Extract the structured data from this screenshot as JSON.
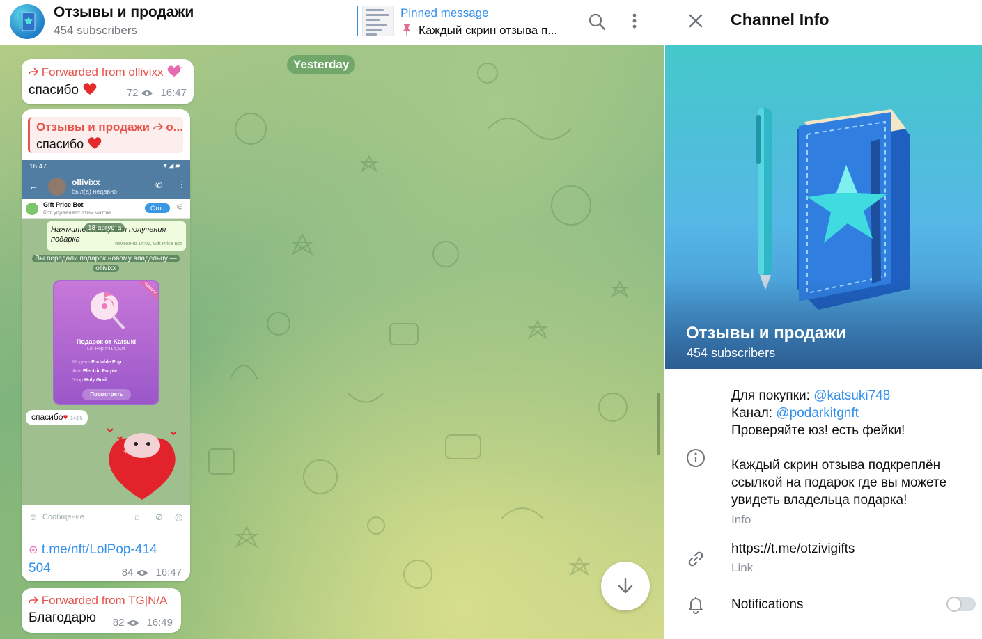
{
  "header": {
    "channel_name": "Отзывы и продажи",
    "subscribers": "454 subscribers",
    "pinned_label": "Pinned message",
    "pinned_text": "Каждый скрин отзыва п..."
  },
  "chat": {
    "date_chip": "Yesterday",
    "messages": [
      {
        "forwarded": "Forwarded from ollivixx",
        "text": "спасибо",
        "views": "72",
        "time": "16:47"
      },
      {
        "reply_title": "Отзывы и продажи",
        "reply_suffix": "о...",
        "reply_text": "спасибо",
        "link_line1": "t.me/nft/LolPop-414",
        "link_line2": "504",
        "views": "84",
        "time": "16:47"
      },
      {
        "forwarded": "Forwarded from TG|N/A",
        "text": "Благодарю",
        "views": "82",
        "time": "16:49"
      }
    ],
    "screenshot": {
      "status_time": "16:47",
      "contact_name": "ollivixx",
      "contact_status": "был(а) недавно",
      "bot_name": "Gift Price Bot",
      "bot_desc": "бот управляет этим чатом",
      "bot_button": "Стоп",
      "date": "18 августа",
      "bot_message": "Нажмите кнопку для получения подарка",
      "bot_message_meta": "изменено 14:06, Gift Price Bot",
      "service_line1": "Вы передали подарок новому владельцу —",
      "service_line2": "ollivixx",
      "gift_ribbon": "подарок",
      "gift_title": "Подарок от Katsuki",
      "gift_sub": "Lol Pop #414,504",
      "gift_rows": [
        {
          "k": "Модель",
          "v": "Portable Pop"
        },
        {
          "k": "Фон",
          "v": "Electric Purple"
        },
        {
          "k": "Узор",
          "v": "Holy Grail"
        }
      ],
      "gift_button": "Посмотреть",
      "reply_thanks": "спасибо",
      "reply_time": "14:06",
      "input_placeholder": "Сообщение"
    }
  },
  "panel": {
    "title": "Channel Info",
    "cover_name": "Отзывы и продажи",
    "cover_subs": "454 subscribers",
    "info_buy_label": "Для покупки:",
    "info_buy_handle": "@katsuki748",
    "info_channel_label": "Канал:",
    "info_channel_handle": "@podarkitgnft",
    "info_line3": "Проверяйте юз! есть фейки!",
    "info_line4": "Каждый скрин отзыва подкреплён",
    "info_line5": "ссылкой на подарок где вы можете",
    "info_line6": "увидеть владельца подарка!",
    "info_caption": "Info",
    "link_value": "https://t.me/otzivigifts",
    "link_caption": "Link",
    "notifications_label": "Notifications",
    "notifications_on": false
  },
  "colors": {
    "accent": "#3390ec",
    "forward_red": "#e5534b",
    "muted": "#8a9199"
  },
  "icons": [
    "search-icon",
    "more-vertical-icon",
    "pin-icon",
    "close-icon",
    "info-icon",
    "link-icon",
    "bell-icon",
    "arrow-down-icon",
    "eye-icon",
    "forward-icon",
    "heart-icon"
  ]
}
